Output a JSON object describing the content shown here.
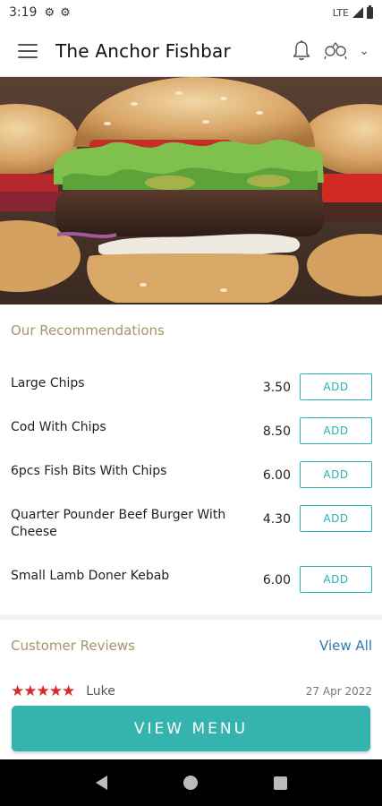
{
  "status_bar": {
    "time": "3:19",
    "network": "LTE"
  },
  "app_bar": {
    "title": "The Anchor Fishbar"
  },
  "recommendations": {
    "heading": "Our Recommendations",
    "add_label": "ADD",
    "items": [
      {
        "name": "Large Chips",
        "price": "3.50"
      },
      {
        "name": "Cod With Chips",
        "price": "8.50"
      },
      {
        "name": "6pcs Fish Bits With Chips",
        "price": "6.00"
      },
      {
        "name": "Quarter Pounder Beef Burger With Cheese",
        "price": "4.30"
      },
      {
        "name": "Small Lamb Doner Kebab",
        "price": "6.00"
      }
    ]
  },
  "reviews": {
    "heading": "Customer Reviews",
    "view_all": "View All",
    "latest": {
      "stars": "★★★★★",
      "rating": 5,
      "reviewer": "Luke",
      "date": "27 Apr 2022"
    }
  },
  "view_menu_label": "VIEW MENU",
  "colors": {
    "accent": "#35b3ae",
    "heading_gold": "#a89468",
    "star_red": "#d42a2a",
    "link_blue": "#2b79a8"
  }
}
